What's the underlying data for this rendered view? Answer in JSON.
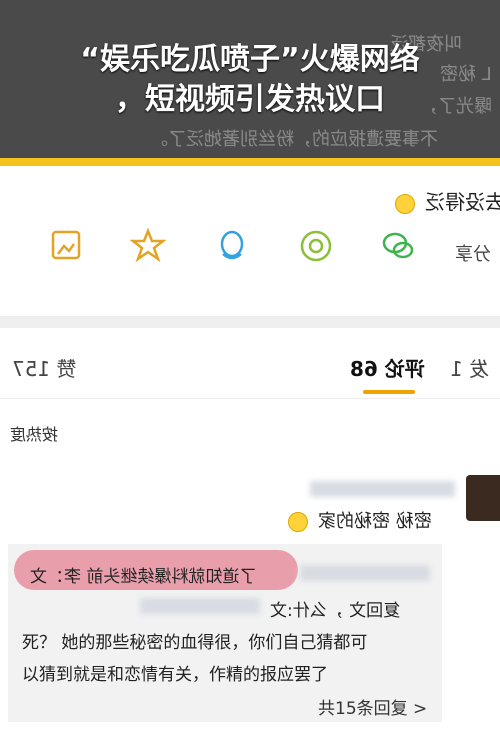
{
  "headline": {
    "line1": "“娱乐吃瓜喷子”火爆网络",
    "line2": "，短视频引发热议口"
  },
  "background_post": {
    "line1": "叫夜都泛",
    "line2": "L 秘密",
    "line3": "曝光了，",
    "line4": "不事要遭报应的，粉丝别著她泛了。",
    "wait_text": "去没得泛"
  },
  "share_bar": {
    "label": "分享",
    "icons": [
      "save-image-icon",
      "favorite-icon",
      "qq-icon",
      "moments-icon",
      "wechat-icon"
    ]
  },
  "tabs": {
    "likes": "赞 157",
    "comments": "评论 68",
    "reposts": "发 1"
  },
  "sort": {
    "label": "按热度"
  },
  "comment": {
    "text": "密秘 密秘的家",
    "reply_line1": "了道知就料爆续继头前 李：文",
    "reply_line2": "复回文 ，么什:文",
    "reply_line3": "死？ 她的那些秘密的血得很，你们自己猜都可",
    "reply_line4": "以猜到就是和恋情有关，作精的报应罢了",
    "more_replies": "共15条回复 >"
  },
  "colors": {
    "accent": "#f6c21c",
    "tab_underline": "#f0a200",
    "highlight": "#e68a99"
  }
}
